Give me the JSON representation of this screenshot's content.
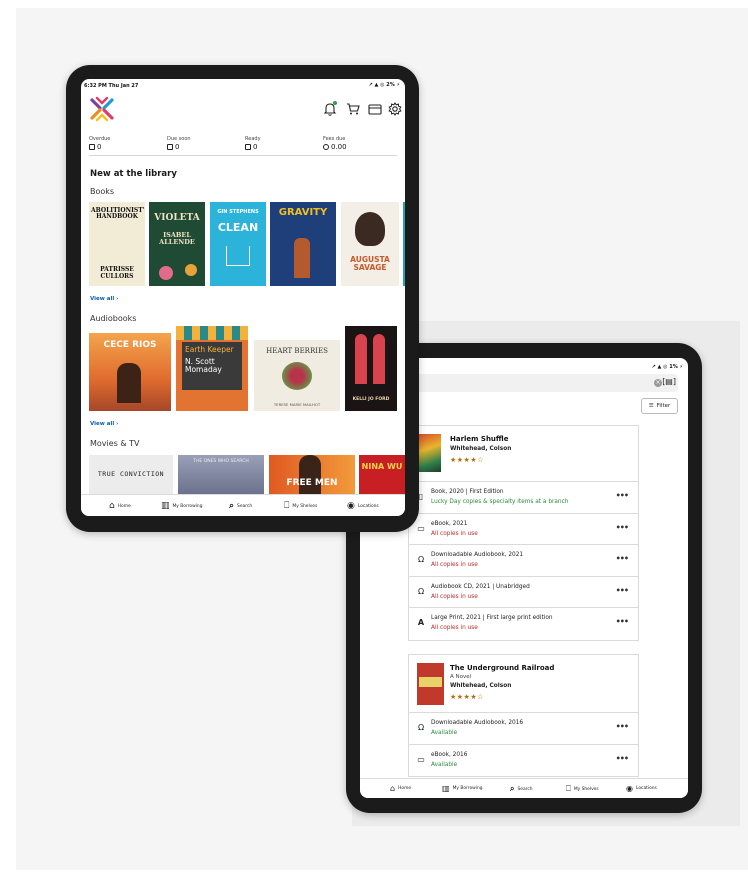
{
  "tablet_home": {
    "status": {
      "time": "6:32 PM  Thu Jan 27",
      "icons": "↗ ▲ ◎ 2% ⚡"
    },
    "stats": [
      {
        "label": "Overdue",
        "value": "0"
      },
      {
        "label": "Due soon",
        "value": "0"
      },
      {
        "label": "Ready",
        "value": "0"
      },
      {
        "label": "Fees due",
        "value": "0.00"
      }
    ],
    "section_title": "New at the library",
    "books_title": "Books",
    "books": [
      {
        "title": "12 STEPS to CHANGING YOURSELF and the WORLD AN ABOLITIONIST'S HANDBOOK BY PATRISSE CULLORS",
        "short": "ABOLITIONIST'S HANDBOOK",
        "author": "PATRISSE CULLORS"
      },
      {
        "title": "VIOLETA",
        "author": "ISABEL ALLENDE"
      },
      {
        "title": "CLEAN",
        "author": "GIN STEPHENS"
      },
      {
        "title": "GRAVITY",
        "author": ""
      },
      {
        "title": "AUGUSTA SAVAGE",
        "author": ""
      }
    ],
    "audiobooks_title": "Audiobooks",
    "audiobooks": [
      {
        "title": "CECE RIOS",
        "author": ""
      },
      {
        "title": "Earth Keeper",
        "author": "N. Scott Momaday"
      },
      {
        "title": "HEART BERRIES",
        "author": "TERESE MARIE MAILHOT"
      },
      {
        "title": "",
        "author": "KELLI JO FORD"
      }
    ],
    "movies_title": "Movies & TV",
    "movies": [
      {
        "title": "TRUE CONVICTION"
      },
      {
        "title": "THE ONES WHO SEARCH"
      },
      {
        "title": "FREE MEN"
      },
      {
        "title": "NINA WU"
      }
    ],
    "view_all": "View all ›",
    "tabbar": [
      {
        "label": "Home"
      },
      {
        "label": "My Borrowing"
      },
      {
        "label": "Search"
      },
      {
        "label": "My Shelves"
      },
      {
        "label": "Locations"
      }
    ]
  },
  "tablet_search": {
    "status": "↗ ▲ ◎ 1% ⚡",
    "query": "ehead",
    "filter_label": "Filter",
    "results": [
      {
        "title": "Harlem Shuffle",
        "subtitle": "",
        "author": "Whitehead, Colson",
        "stars": "★★★★☆",
        "formats": [
          {
            "icon": "book-icon",
            "line1": "Book, 2020 | First Edition",
            "line2": "Lucky Day copies & specialty items at a branch",
            "status": "green"
          },
          {
            "icon": "tablet-icon",
            "line1": "eBook, 2021",
            "line2": "All copies in use",
            "status": "red"
          },
          {
            "icon": "headphones-icon",
            "line1": "Downloadable Audiobook, 2021",
            "line2": "All copies in use",
            "status": "red"
          },
          {
            "icon": "headphones-icon",
            "line1": "Audiobook CD, 2021 | Unabridged",
            "line2": "All copies in use",
            "status": "red"
          },
          {
            "icon": "large-print-icon",
            "line1": "Large Print, 2021 | First large print edition",
            "line2": "All copies in use",
            "status": "red"
          }
        ]
      },
      {
        "title": "The Underground Railroad",
        "subtitle": "A Novel",
        "author": "Whitehead, Colson",
        "stars": "★★★★☆",
        "formats": [
          {
            "icon": "headphones-icon",
            "line1": "Downloadable Audiobook, 2016",
            "line2": "Available",
            "status": "green"
          },
          {
            "icon": "tablet-icon",
            "line1": "eBook, 2016",
            "line2": "Available",
            "status": "green"
          }
        ]
      }
    ],
    "tabbar": [
      {
        "label": "Home"
      },
      {
        "label": "My Borrowing"
      },
      {
        "label": "Search"
      },
      {
        "label": "My Shelves"
      },
      {
        "label": "Locations"
      }
    ]
  },
  "colors": {
    "link": "#0a5fb3",
    "available": "#2e8b3a",
    "unavailable": "#c62828",
    "stars": "#b06e0c"
  }
}
